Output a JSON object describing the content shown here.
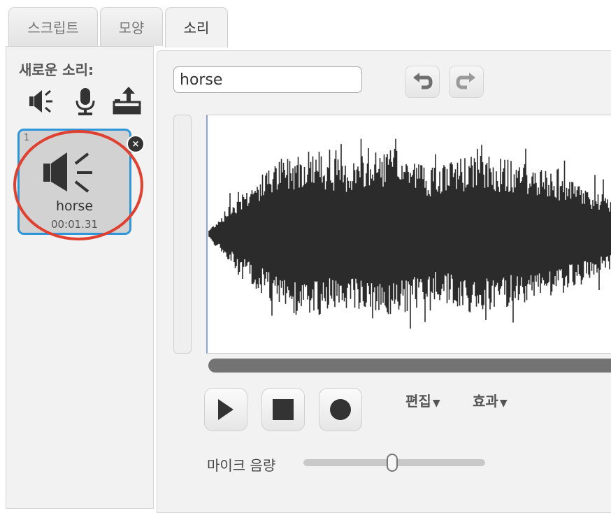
{
  "tabs": [
    {
      "label": "스크립트"
    },
    {
      "label": "모양"
    },
    {
      "label": "소리"
    }
  ],
  "new_sound": {
    "label": "새로운 소리:",
    "tools": [
      {
        "icon": "speaker-library-icon"
      },
      {
        "icon": "microphone-icon"
      },
      {
        "icon": "upload-icon"
      }
    ]
  },
  "sound_list": {
    "items": [
      {
        "number": "1",
        "name": "horse",
        "duration": "00:01.31",
        "icon": "speaker-icon"
      }
    ]
  },
  "editor": {
    "sound_name": "horse",
    "undo_icon": "undo-icon",
    "redo_icon": "redo-icon",
    "menus": {
      "edit": "편집",
      "effects": "효과"
    },
    "mic_volume_label": "마이크 음량",
    "mic_volume_level": 0.49
  },
  "colors": {
    "selection_border": "#2e96d8",
    "highlight_ring": "#e0402f",
    "waveform": "#2b2b2b"
  }
}
